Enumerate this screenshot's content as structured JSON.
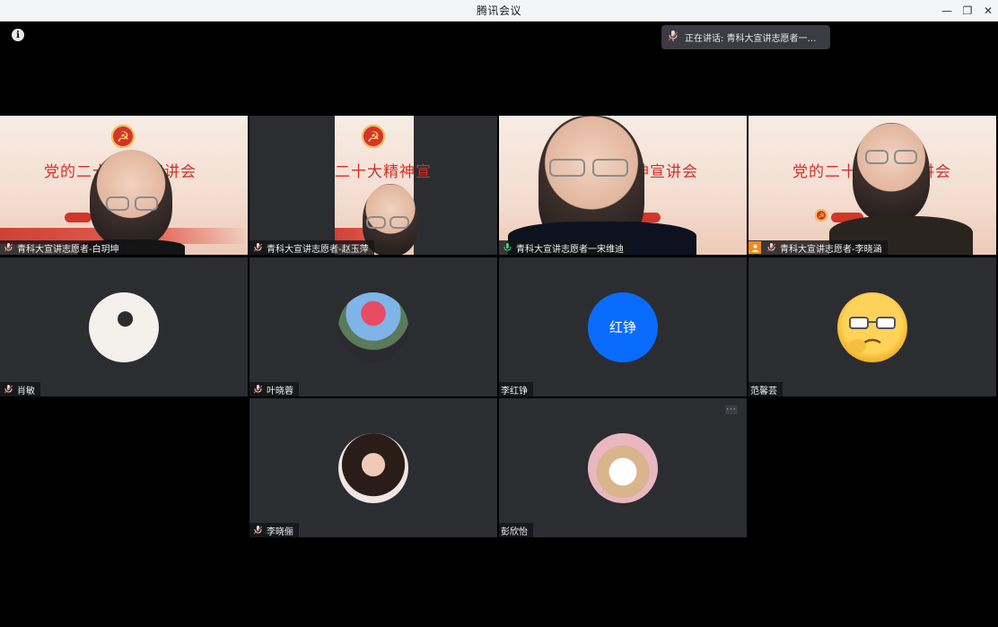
{
  "window": {
    "title": "腾讯会议",
    "controls": {
      "minimize": "—",
      "maximize": "❐",
      "close": "✕"
    }
  },
  "info_icon_glyph": "i",
  "speaking": {
    "text": "正在讲话: 青科大宣讲志愿者一…"
  },
  "slide_text": {
    "t1": "党的二十",
    "t1b": "宣讲会",
    "t2": "二十大精神宣",
    "t3": "神宣讲会",
    "t4": "党的二十",
    "t4b": "讲会"
  },
  "participants": [
    {
      "name": "青科大宣讲志愿者-白玥坤"
    },
    {
      "name": "青科大宣讲志愿者-赵玉萍"
    },
    {
      "name": "青科大宣讲志愿者一宋维迪"
    },
    {
      "name": "青科大宣讲志愿者-李晓涵"
    },
    {
      "name": "肖敏"
    },
    {
      "name": "叶晓蓉"
    },
    {
      "name": "李红铮",
      "avatar_text": "红铮"
    },
    {
      "name": "范馨芸"
    },
    {
      "name": "李晓俪"
    },
    {
      "name": "彭欣怡"
    }
  ],
  "icons": {
    "mic": "microphone-muted-icon",
    "mic_active": "microphone-active-icon",
    "user": "user-icon",
    "more": "more-icon"
  },
  "colors": {
    "tile_bg": "#2b2d31",
    "accent_blue": "#0a6cff",
    "active_green": "#2fb36a",
    "badge_orange": "#f08b1f"
  }
}
